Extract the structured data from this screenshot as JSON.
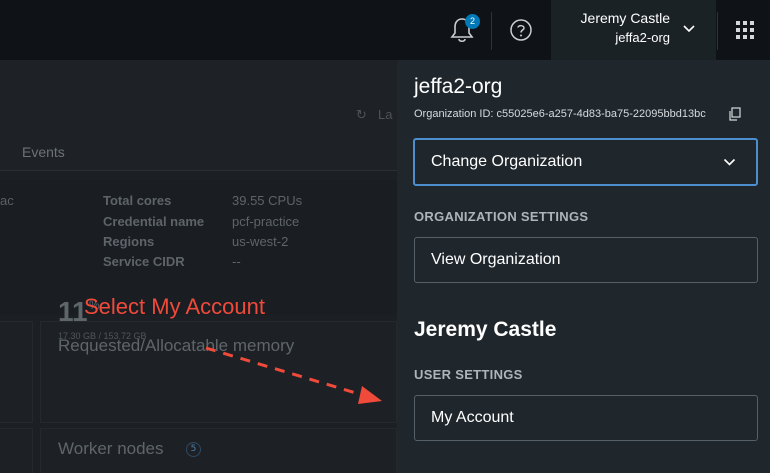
{
  "header": {
    "notification_count": "2",
    "user_name": "Jeremy Castle",
    "user_org": "jeffa2-org"
  },
  "background": {
    "refresh_label": "La",
    "tab_label": "Events",
    "left_fragment": "ac",
    "details": [
      {
        "label": "Total cores",
        "value": "39.55 CPUs"
      },
      {
        "label": "Credential name",
        "value": "pcf-practice"
      },
      {
        "label": "Regions",
        "value": "us-west-2"
      },
      {
        "label": "Service CIDR",
        "value": "--"
      }
    ],
    "memory_card": {
      "title": "Requested/Allocatable memory",
      "value": "11",
      "unit": "%",
      "sub": "17.30 GB / 153.72 GB"
    },
    "worker_card": {
      "title": "Worker nodes",
      "count": "5"
    }
  },
  "annotation": {
    "text": "Select My Account",
    "color": "#f04a3a"
  },
  "panel": {
    "org_name": "jeffa2-org",
    "org_id": "Organization ID: c55025e6-a257-4d83-ba75-22095bbd13bc",
    "change_org_label": "Change Organization",
    "org_settings_heading": "ORGANIZATION SETTINGS",
    "view_org_label": "View Organization",
    "user_name": "Jeremy Castle",
    "user_settings_heading": "USER SETTINGS",
    "my_account_label": "My Account"
  },
  "colors": {
    "accent": "#0079b8",
    "focus_border": "#4d8ecf",
    "panel_bg": "#1f272d"
  }
}
